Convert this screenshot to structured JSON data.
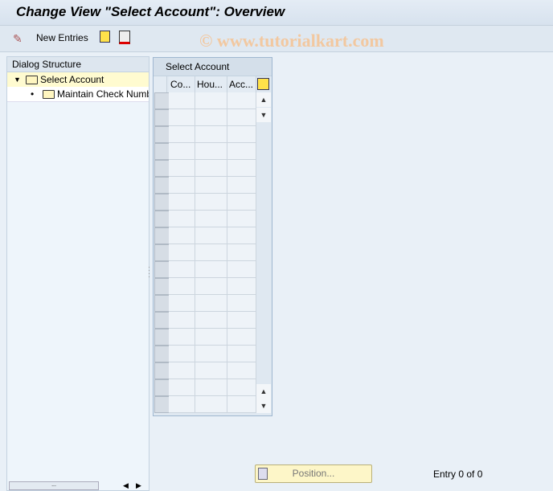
{
  "title": "Change View \"Select Account\": Overview",
  "toolbar": {
    "new_entries": "New Entries"
  },
  "watermark": "© www.tutorialkart.com",
  "dialog": {
    "header": "Dialog Structure",
    "items": [
      {
        "label": "Select Account",
        "selected": true
      },
      {
        "label": "Maintain Check Numb"
      }
    ]
  },
  "table": {
    "title": "Select Account",
    "columns": [
      "Co...",
      "Hou...",
      "Acc..."
    ],
    "rows": 19
  },
  "footer": {
    "position": "Position...",
    "entry": "Entry 0 of 0"
  }
}
